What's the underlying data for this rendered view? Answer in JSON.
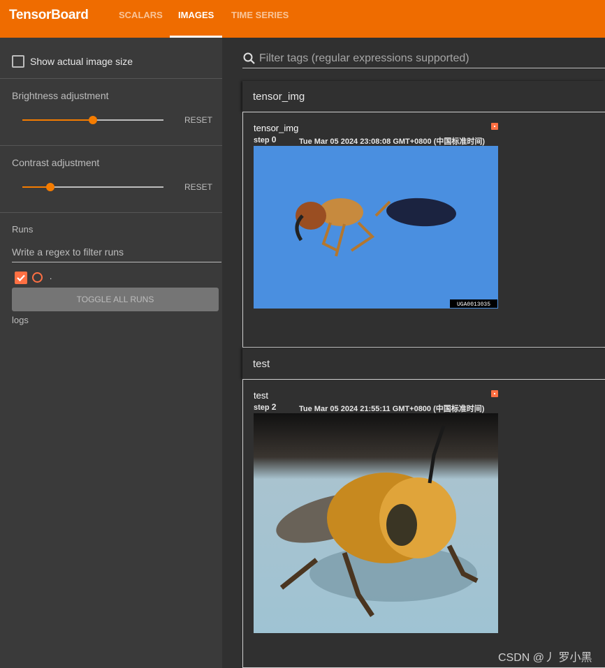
{
  "app": {
    "title": "TensorBoard",
    "accent": "#ef6c00",
    "run_color": "#ff7043"
  },
  "tabs": [
    {
      "label": "SCALARS",
      "active": false
    },
    {
      "label": "IMAGES",
      "active": true
    },
    {
      "label": "TIME SERIES",
      "active": false
    }
  ],
  "sidebar": {
    "show_actual_size": {
      "label": "Show actual image size",
      "checked": false
    },
    "brightness": {
      "label": "Brightness adjustment",
      "value_fraction": 0.5,
      "reset_label": "RESET"
    },
    "contrast": {
      "label": "Contrast adjustment",
      "value_fraction": 0.2,
      "reset_label": "RESET"
    },
    "runs": {
      "label": "Runs",
      "filter_placeholder": "Write a regex to filter runs",
      "items": [
        {
          "name": ".",
          "checked": true
        }
      ],
      "toggle_all_label": "TOGGLE ALL RUNS",
      "logdir": "logs"
    }
  },
  "main": {
    "filter_placeholder": "Filter tags (regular expressions supported)",
    "groups": [
      {
        "title": "tensor_img",
        "card": {
          "title": "tensor_img",
          "step_label": "step",
          "step": "0",
          "timestamp": "Tue Mar 05 2024 23:08:08 GMT+0800 (中国标准时间)",
          "image_alt": "ant on blue background",
          "image_caption": "UGA0013035"
        }
      },
      {
        "title": "test",
        "card": {
          "title": "test",
          "step_label": "step",
          "step": "2",
          "timestamp": "Tue Mar 05 2024 21:55:11 GMT+0800 (中国标准时间)",
          "image_alt": "bee on light blue surface"
        }
      }
    ]
  },
  "watermark": "CSDN @丿 罗小黑"
}
